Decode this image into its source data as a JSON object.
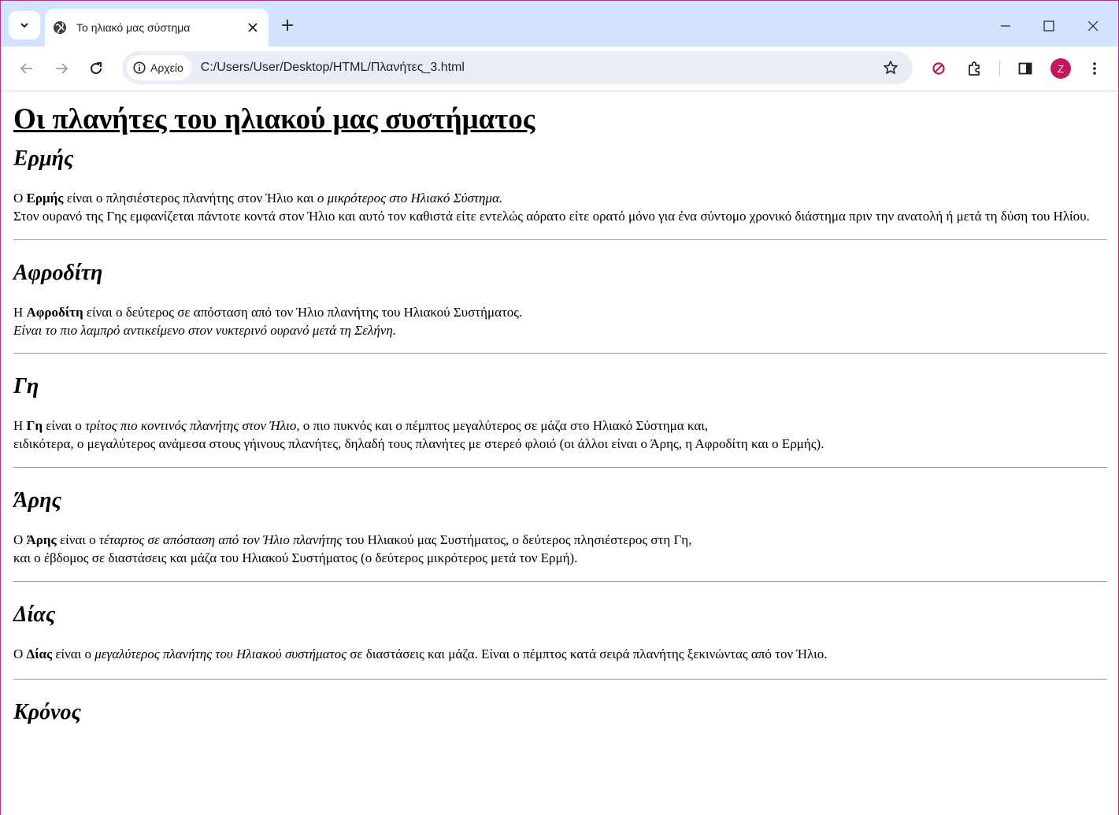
{
  "browser": {
    "tab_title": "Το ηλιακό μας σύστημα",
    "chip_label": "Αρχείο",
    "url": "C:/Users/User/Desktop/HTML/Πλανήτες_3.html",
    "avatar_letter": "Z",
    "accent": "#d3e3fd"
  },
  "page": {
    "heading": "Οι πλανήτες του ηλιακού μας συστήματος",
    "sections": [
      {
        "title": "Ερμής",
        "p1": [
          "Ο ",
          "Ερμής",
          " είναι ο πλησιέστερος πλανήτης στον Ήλιο και ",
          "ο μικρότερος στο Ηλιακό Σύστημα."
        ],
        "p2": "Στον ουρανό της Γης εμφανίζεται πάντοτε κοντά στον Ήλιο και αυτό τον καθιστά είτε εντελώς αόρατο είτε ορατό μόνο για ένα σύντομο χρονικό διάστημα πριν την ανατολή ή μετά τη δύση του Ηλίου."
      },
      {
        "title": "Αφροδίτη",
        "p1": [
          "Η ",
          "Αφροδίτη",
          " είναι ο δεύτερος σε απόσταση από τον Ήλιο πλανήτης του Ηλιακού Συστήματος."
        ],
        "p2": "Είναι το πιο λαμπρό αντικείμενο στον νυκτερινό ουρανό μετά τη Σελήνη."
      },
      {
        "title": "Γη",
        "p1": [
          "Η ",
          "Γη",
          " είναι ο ",
          "τρίτος πιο κοντινός πλανήτης στον Ήλιο,",
          " ο πιο πυκνός και ο πέμπτος μεγαλύτερος σε μάζα στο Ηλιακό Σύστημα και,"
        ],
        "p2": "ειδικότερα, ο μεγαλύτερος ανάμεσα στους γήινους πλανήτες, δηλαδή τους πλανήτες με στερεό φλοιό (οι άλλοι είναι ο Άρης, η Αφροδίτη και ο Ερμής)."
      },
      {
        "title": "Άρης",
        "p1": [
          "Ο ",
          "Άρης",
          " είναι ο ",
          "τέταρτος σε απόσταση από τον Ήλιο πλανήτης",
          " του Ηλιακού μας Συστήματος, ο δεύτερος πλησιέστερος στη Γη,"
        ],
        "p2": "και ο έβδομος σε διαστάσεις και μάζα του Ηλιακού Συστήματος (ο δεύτερος μικρότερος μετά τον Ερμή)."
      },
      {
        "title": "Δίας",
        "p1": [
          "Ο ",
          "Δίας",
          " είναι ο ",
          "μεγαλύτερος πλανήτης του Ηλιακού συστήματος",
          " σε διαστάσεις και μάζα. Είναι ο πέμπτος κατά σειρά πλανήτης ξεκινώντας από τον Ήλιο."
        ]
      },
      {
        "title": "Κρόνος"
      }
    ]
  }
}
